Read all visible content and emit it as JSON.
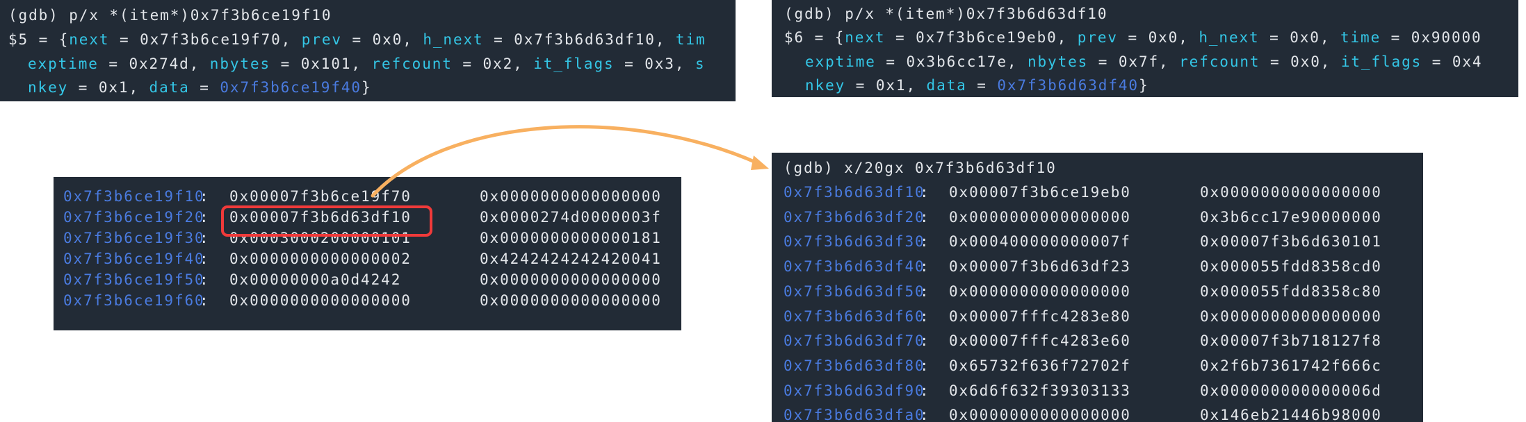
{
  "colors": {
    "background": "#222b36",
    "text": "#e3e6ea",
    "field": "#34c6e6",
    "address": "#4a7be0",
    "highlight_box": "#f03a3a",
    "arrow": "#f8b060"
  },
  "panel1": {
    "command": "(gdb) p/x *(item*)0x7f3b6ce19f10",
    "l2": {
      "prefix": "$5 = {",
      "f1": "next",
      "v1": " = 0x7f3b6ce19f70, ",
      "f2": "prev",
      "v2": " = 0x0, ",
      "f3": "h_next",
      "v3": " = 0x7f3b6d63df10, ",
      "f4": "tim"
    },
    "l3": {
      "f1": "exptime",
      "v1": " = 0x274d, ",
      "f2": "nbytes",
      "v2": " = 0x101, ",
      "f3": "refcount",
      "v3": " = 0x2, ",
      "f4": "it_flags",
      "v4": " = 0x3, ",
      "f5": "s"
    },
    "l4": {
      "f1": "nkey",
      "v1": " = 0x1, ",
      "f2": "data",
      "v2": " = ",
      "addr": "0x7f3b6ce19f40",
      "end": "}"
    }
  },
  "panel2": {
    "command": "(gdb) p/x *(item*)0x7f3b6d63df10",
    "l2": {
      "prefix": "$6 = {",
      "f1": "next",
      "v1": " = 0x7f3b6ce19eb0, ",
      "f2": "prev",
      "v2": " = 0x0, ",
      "f3": "h_next",
      "v3": " = 0x0, ",
      "f4": "time",
      "v4": " = 0x90000"
    },
    "l3": {
      "f1": "exptime",
      "v1": " = 0x3b6cc17e, ",
      "f2": "nbytes",
      "v2": " = 0x7f, ",
      "f3": "refcount",
      "v3": " = 0x0, ",
      "f4": "it_flags",
      "v4": " = 0x4"
    },
    "l4": {
      "f1": "nkey",
      "v1": " = 0x1, ",
      "f2": "data",
      "v2": " = ",
      "addr": "0x7f3b6d63df40",
      "end": "}"
    }
  },
  "panel3": {
    "rows": [
      {
        "addr": "0x7f3b6ce19f10",
        "v1": "0x00007f3b6ce19f70",
        "v2": "0x0000000000000000"
      },
      {
        "addr": "0x7f3b6ce19f20",
        "v1": "0x00007f3b6d63df10",
        "v2": "0x0000274d0000003f"
      },
      {
        "addr": "0x7f3b6ce19f30",
        "v1": "0x0003000200000101",
        "v2": "0x0000000000000181"
      },
      {
        "addr": "0x7f3b6ce19f40",
        "v1": "0x0000000000000002",
        "v2": "0x4242424242420041"
      },
      {
        "addr": "0x7f3b6ce19f50",
        "v1": "0x00000000a0d4242",
        "v2": "0x0000000000000000"
      },
      {
        "addr": "0x7f3b6ce19f60",
        "v1": "0x0000000000000000",
        "v2": "0x0000000000000000"
      }
    ]
  },
  "panel4": {
    "command": "(gdb) x/20gx 0x7f3b6d63df10",
    "rows": [
      {
        "addr": "0x7f3b6d63df10",
        "v1": "0x00007f3b6ce19eb0",
        "v2": "0x0000000000000000"
      },
      {
        "addr": "0x7f3b6d63df20",
        "v1": "0x0000000000000000",
        "v2": "0x3b6cc17e90000000"
      },
      {
        "addr": "0x7f3b6d63df30",
        "v1": "0x000400000000007f",
        "v2": "0x00007f3b6d630101"
      },
      {
        "addr": "0x7f3b6d63df40",
        "v1": "0x00007f3b6d63df23",
        "v2": "0x000055fdd8358cd0"
      },
      {
        "addr": "0x7f3b6d63df50",
        "v1": "0x0000000000000000",
        "v2": "0x000055fdd8358c80"
      },
      {
        "addr": "0x7f3b6d63df60",
        "v1": "0x00007fffc4283e80",
        "v2": "0x0000000000000000"
      },
      {
        "addr": "0x7f3b6d63df70",
        "v1": "0x00007fffc4283e60",
        "v2": "0x00007f3b718127f8"
      },
      {
        "addr": "0x7f3b6d63df80",
        "v1": "0x65732f636f72702f",
        "v2": "0x2f6b7361742f666c"
      },
      {
        "addr": "0x7f3b6d63df90",
        "v1": "0x6d6f632f39303133",
        "v2": "0x000000000000006d"
      },
      {
        "addr": "0x7f3b6d63dfa0",
        "v1": "0x0000000000000000",
        "v2": "0x146eb21446b98000"
      }
    ]
  }
}
